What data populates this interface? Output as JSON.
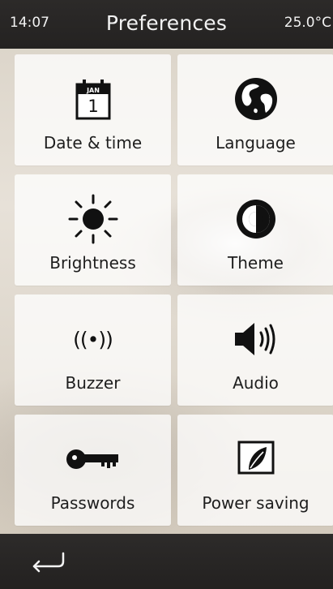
{
  "status": {
    "time": "14:07",
    "title": "Preferences",
    "temperature": "25.0°C"
  },
  "tiles": [
    {
      "label": "Date & time",
      "icon": "calendar-icon",
      "calendar_month": "JAN",
      "calendar_day": "1"
    },
    {
      "label": "Language",
      "icon": "globe-icon"
    },
    {
      "label": "Brightness",
      "icon": "sun-icon"
    },
    {
      "label": "Theme",
      "icon": "theme-contrast-icon"
    },
    {
      "label": "Buzzer",
      "icon": "buzzer-signal-icon",
      "glyph": "((•))"
    },
    {
      "label": "Audio",
      "icon": "speaker-icon"
    },
    {
      "label": "Passwords",
      "icon": "key-icon"
    },
    {
      "label": "Power saving",
      "icon": "leaf-screen-icon"
    }
  ],
  "navigation": {
    "back_icon": "back-arrow-icon"
  },
  "colors": {
    "bar_background": "#2a2827",
    "bar_text": "#f2f2f2",
    "tile_background": "rgba(255,255,255,0.76)",
    "icon_color": "#111111"
  }
}
